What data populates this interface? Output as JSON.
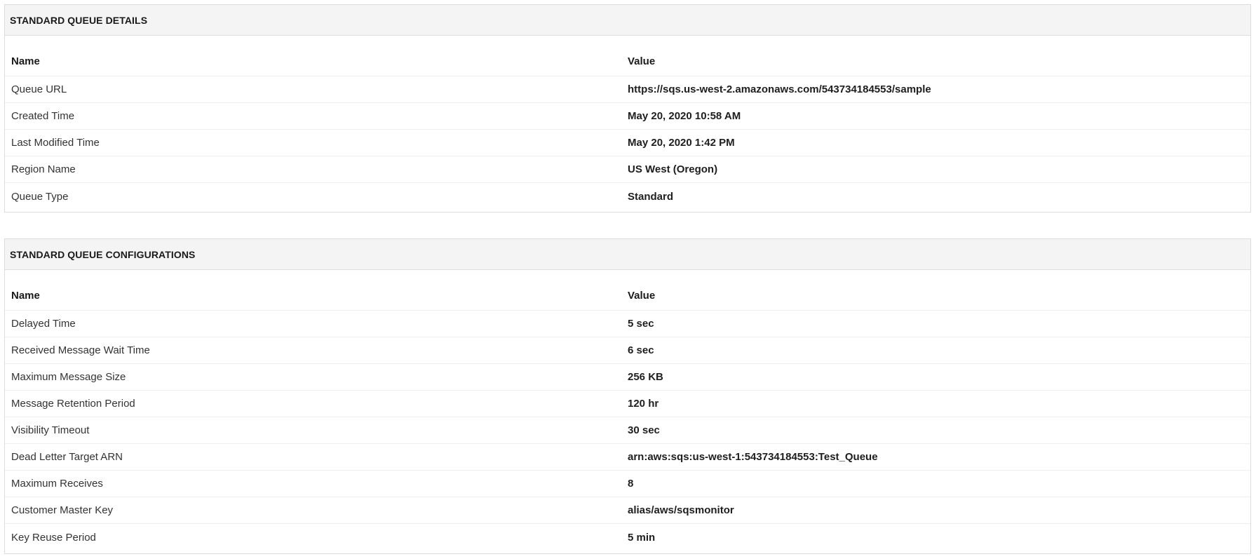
{
  "details": {
    "title": "STANDARD QUEUE DETAILS",
    "columns": {
      "name": "Name",
      "value": "Value"
    },
    "rows": [
      {
        "name": "Queue URL",
        "value": "https://sqs.us-west-2.amazonaws.com/543734184553/sample"
      },
      {
        "name": "Created Time",
        "value": "May 20, 2020 10:58 AM"
      },
      {
        "name": "Last Modified Time",
        "value": "May 20, 2020 1:42 PM"
      },
      {
        "name": "Region Name",
        "value": "US West (Oregon)"
      },
      {
        "name": "Queue Type",
        "value": "Standard"
      }
    ]
  },
  "config": {
    "title": "STANDARD QUEUE CONFIGURATIONS",
    "columns": {
      "name": "Name",
      "value": "Value"
    },
    "rows": [
      {
        "name": "Delayed Time",
        "value": "5 sec"
      },
      {
        "name": "Received Message Wait Time",
        "value": "6 sec"
      },
      {
        "name": "Maximum Message Size",
        "value": "256 KB"
      },
      {
        "name": "Message Retention Period",
        "value": "120 hr"
      },
      {
        "name": "Visibility Timeout",
        "value": "30 sec"
      },
      {
        "name": "Dead Letter Target ARN",
        "value": "arn:aws:sqs:us-west-1:543734184553:Test_Queue"
      },
      {
        "name": "Maximum Receives",
        "value": "8"
      },
      {
        "name": "Customer Master Key",
        "value": "alias/aws/sqsmonitor"
      },
      {
        "name": "Key Reuse Period",
        "value": "5 min"
      }
    ]
  }
}
